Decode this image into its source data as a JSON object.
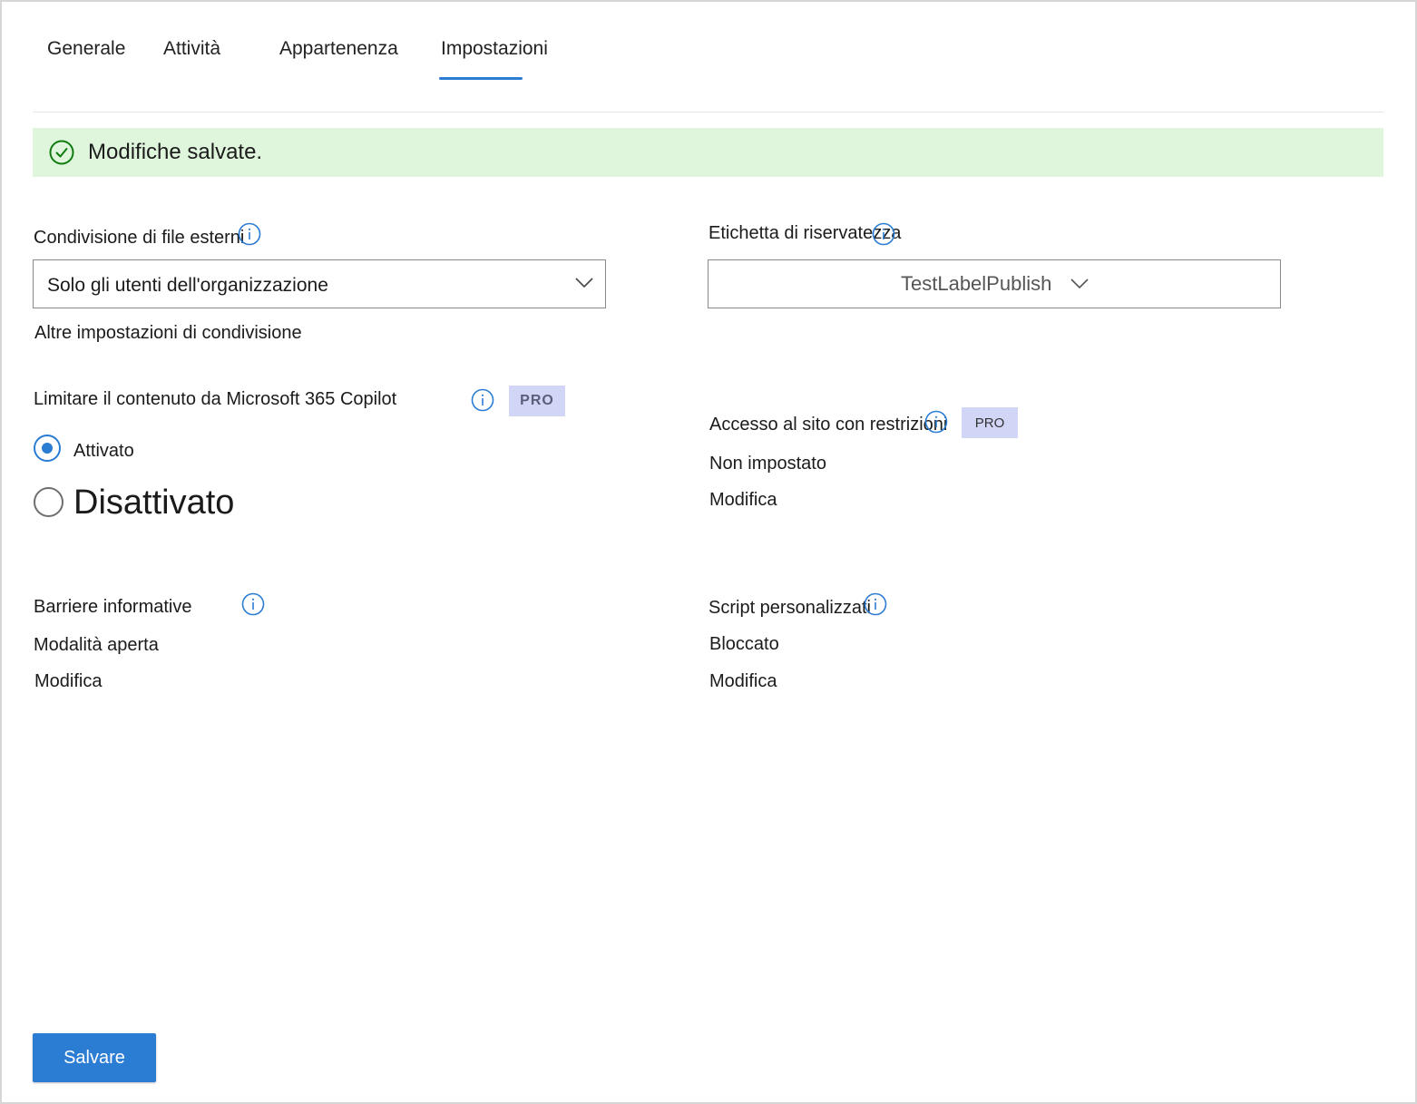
{
  "tabs": [
    {
      "label": "Generale"
    },
    {
      "label": "Attività"
    },
    {
      "label": "Appartenenza"
    },
    {
      "label": "Impostazioni",
      "selected": true
    }
  ],
  "banner": {
    "text": "Modifiche salvate.",
    "icon": "check-circle-icon"
  },
  "external_sharing": {
    "label": "Condivisione di file esterni",
    "selected_value": "Solo gli utenti dell'organizzazione",
    "more_settings_link": "Altre impostazioni di condivisione"
  },
  "sensitivity_label": {
    "label": "Etichetta di riservatezza",
    "selected_value": "TestLabelPublish"
  },
  "copilot": {
    "label": "Limitare il contenuto da Microsoft 365 Copilot",
    "badge": "PRO",
    "options": [
      {
        "label": "Attivato",
        "checked": true
      },
      {
        "label": "Disattivato",
        "checked": false
      }
    ]
  },
  "restricted_access": {
    "label": "Accesso al sito con restrizioni",
    "badge": "PRO",
    "value": "Non impostato",
    "edit_link": "Modifica"
  },
  "info_barriers": {
    "label": "Barriere informative",
    "value": "Modalità aperta",
    "edit_link": "Modifica"
  },
  "custom_scripts": {
    "label": "Script personalizzati",
    "value": "Bloccato",
    "edit_link": "Modifica"
  },
  "save_button": {
    "label": "Salvare"
  },
  "colors": {
    "accent": "#2b7cd3",
    "banner_bg": "#dff6dd",
    "success": "#107c10",
    "pro_bg": "#d1d6f7"
  }
}
